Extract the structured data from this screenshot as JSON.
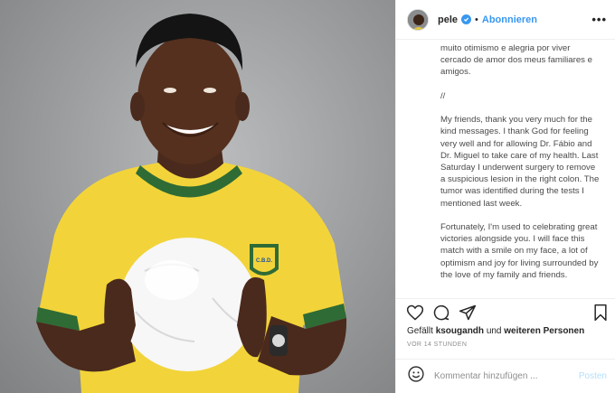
{
  "post": {
    "username": "pele",
    "verified": true,
    "follow_label": "Abonnieren",
    "separator": "•",
    "more_label": "•••"
  },
  "caption": {
    "paragraphs": [
      "muito otimismo e alegria por viver cercado de amor dos meus familiares e amigos.",
      "//",
      "My friends, thank you very much for the kind messages. I thank God for feeling very well and for allowing Dr. Fábio and Dr. Miguel to take care of my health. Last Saturday I underwent surgery to remove a suspicious lesion in the right colon. The tumor was identified during the tests I mentioned last week.",
      "Fortunately, I'm used to celebrating great victories alongside you. I will face this match with a smile on my face, a lot of optimism and joy for living surrounded by the love of my family and friends."
    ]
  },
  "likes": {
    "prefix": "Gefällt",
    "user": "ksougandh",
    "middle": "und",
    "others": "weiteren Personen"
  },
  "timestamp": "VOR 14 STUNDEN",
  "comment": {
    "placeholder": "Kommentar hinzufügen ...",
    "post_label": "Posten"
  },
  "photo": {
    "badge_text": "C.B.D."
  },
  "icons": [
    "heart-icon",
    "comment-icon",
    "share-icon",
    "bookmark-icon",
    "emoji-icon",
    "verified-icon",
    "more-icon"
  ],
  "colors": {
    "link_blue": "#3897f0",
    "post_disabled": "#b2dffc",
    "jersey_yellow": "#f2d43a",
    "collar_green": "#2f6b35"
  }
}
